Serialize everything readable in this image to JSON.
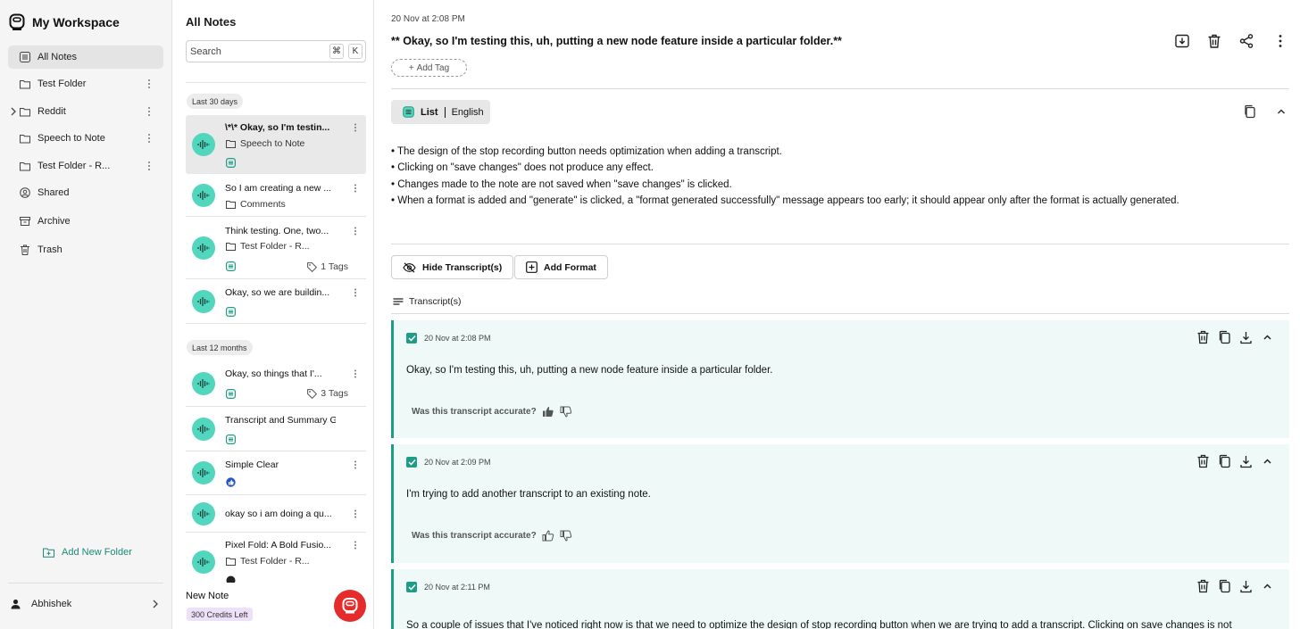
{
  "workspace": {
    "title": "My Workspace",
    "logo_icon": "workspace-logo-icon"
  },
  "sidebar": {
    "items": [
      {
        "label": "All Notes",
        "icon": "list-icon"
      },
      {
        "label": "Test Folder",
        "icon": "folder-icon"
      },
      {
        "label": "Reddit",
        "icon": "folder-icon"
      },
      {
        "label": "Speech to Note",
        "icon": "folder-icon"
      },
      {
        "label": "Test Folder - R...",
        "icon": "folder-icon"
      },
      {
        "label": "Shared",
        "icon": "shared-icon"
      },
      {
        "label": "Archive",
        "icon": "archive-icon"
      },
      {
        "label": "Trash",
        "icon": "trash-icon"
      }
    ],
    "add_folder_label": "Add New Folder",
    "user_name": "Abhishek"
  },
  "notes_panel": {
    "title": "All Notes",
    "search_placeholder": "Search",
    "shortcut_cmd": "⌘",
    "shortcut_key": "K",
    "groups": [
      "Last 30 days",
      "Last 12 months"
    ],
    "notes": [
      {
        "title": "\\*\\* Okay, so I'm testin...",
        "folder": "Speech to Note"
      },
      {
        "title": "So I am creating a new ...",
        "folder": "Comments"
      },
      {
        "title": "Think testing. One, two...",
        "folder": "Test Folder - R...",
        "tags": "1 Tags"
      },
      {
        "title": "Okay, so we are buildin..."
      },
      {
        "title": "Okay, so things that I'...",
        "tags": "3 Tags"
      },
      {
        "title": "Transcript and Summary G..."
      },
      {
        "title": "Simple Clear"
      },
      {
        "title": "okay so i am doing a qu..."
      },
      {
        "title": "Pixel Fold: A Bold Fusio...",
        "folder": "Test Folder - R..."
      }
    ],
    "new_note_label": "New Note",
    "credits_label": "300 Credits Left"
  },
  "note": {
    "date": "20 Nov at 2:08 PM",
    "title": "** Okay, so I'm testing this, uh, putting a new node feature inside a particular folder.**",
    "add_tag_label": "Add Tag",
    "format_type": "List",
    "format_language": "English",
    "summary": [
      "• The design of the stop recording button needs optimization when adding a transcript.",
      "• Clicking on \"save changes\" does not produce any effect.",
      "• Changes made to the note are not saved when \"save changes\" is clicked.",
      "• When a format is added and \"generate\" is clicked, a \"format generated successfully\" message appears too early; it should appear only after the format is actually generated."
    ],
    "hide_transcripts_label": "Hide Transcript(s)",
    "add_format_label": "Add Format",
    "transcripts_label": "Transcript(s)",
    "transcripts": [
      {
        "date": "20 Nov at 2:08 PM",
        "text": "Okay, so I'm testing this, uh, putting a new node feature inside a particular folder.",
        "accuracy_q": "Was this transcript accurate?"
      },
      {
        "date": "20 Nov at 2:09 PM",
        "text": "I'm trying to add another transcript to an existing note.",
        "accuracy_q": "Was this transcript accurate?"
      },
      {
        "date": "20 Nov at 2:11 PM",
        "text": "So a couple of issues that I've noticed right now is that we need to optimize the design of stop recording button when we are trying to add a transcript. Clicking on save changes is not",
        "accuracy_q": ""
      }
    ]
  },
  "colors": {
    "accent": "#1e9c86",
    "wave_bg": "#52d6bd",
    "record": "#e52b2b",
    "card_bg": "#effaf8"
  }
}
